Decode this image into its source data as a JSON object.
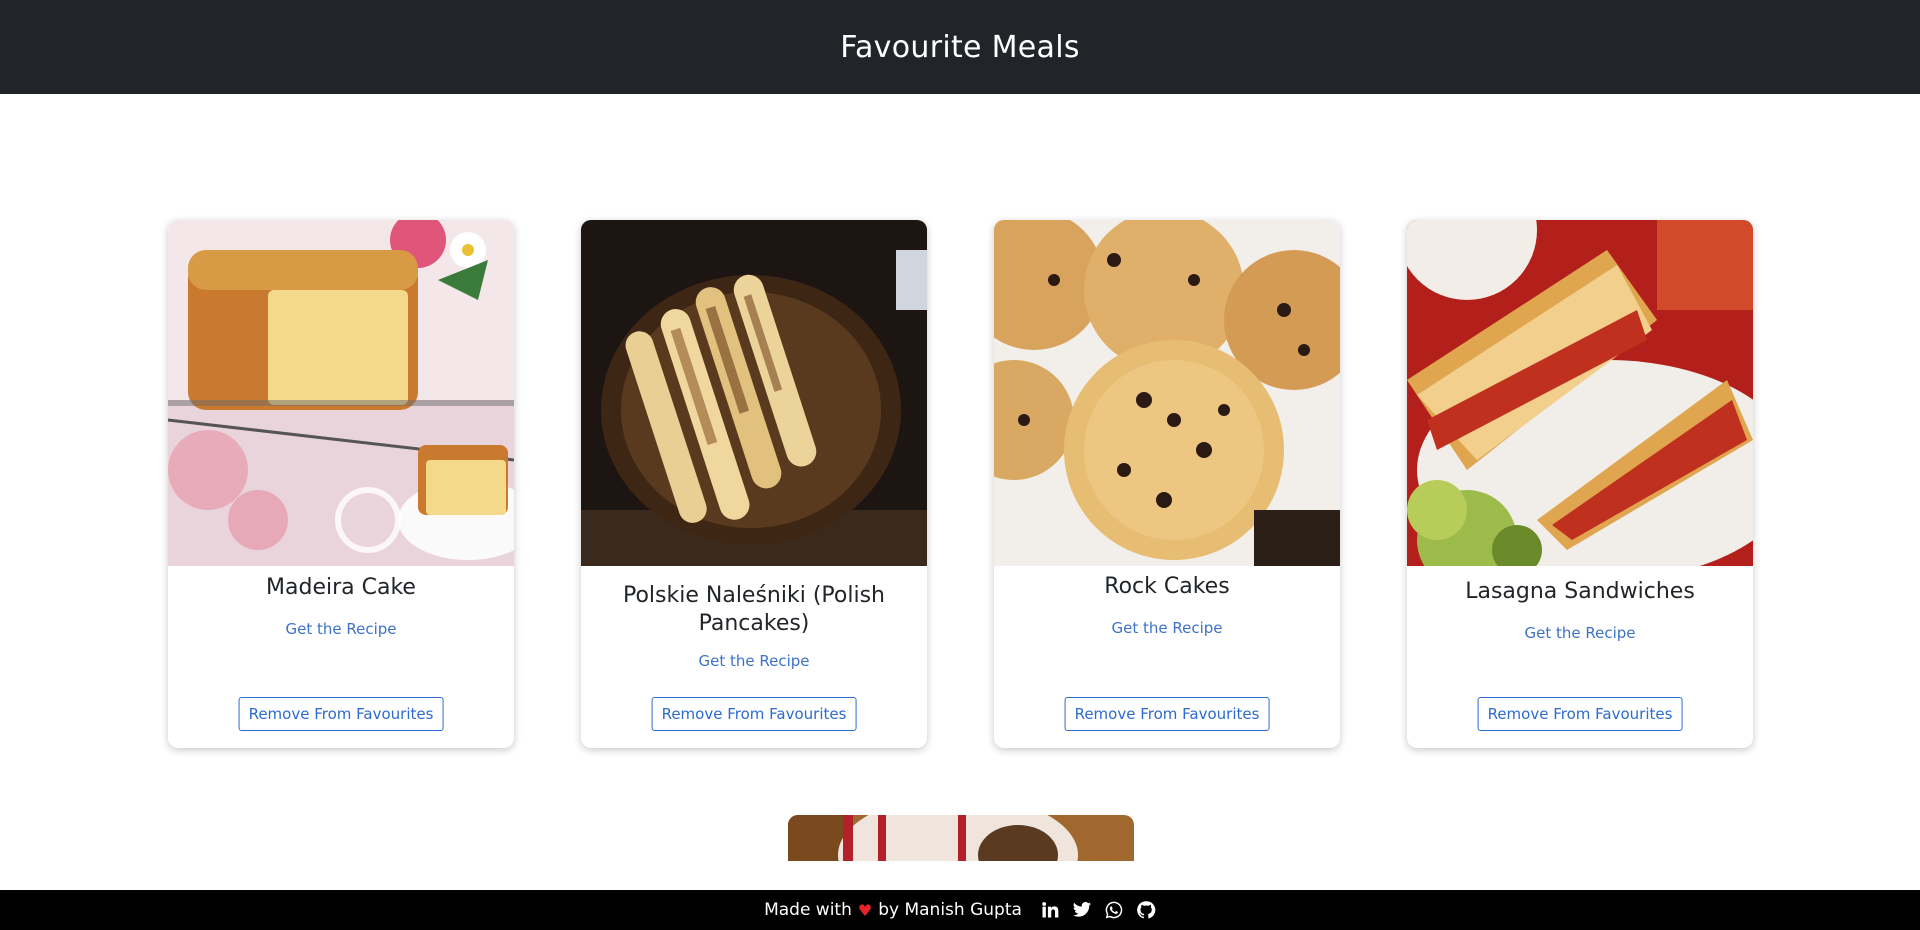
{
  "header": {
    "title": "Favourite Meals"
  },
  "meals": [
    {
      "title": "Madeira Cake",
      "link_label": "Get the Recipe",
      "remove_label": "Remove From Favourites"
    },
    {
      "title": "Polskie Naleśniki (Polish Pancakes)",
      "link_label": "Get the Recipe",
      "remove_label": "Remove From Favourites"
    },
    {
      "title": "Rock Cakes",
      "link_label": "Get the Recipe",
      "remove_label": "Remove From Favourites"
    },
    {
      "title": "Lasagna Sandwiches",
      "link_label": "Get the Recipe",
      "remove_label": "Remove From Favourites"
    }
  ],
  "footer": {
    "made_with": "Made with",
    "heart": "♥",
    "by": "by Manish Gupta",
    "socials": [
      "linkedin-icon",
      "twitter-icon",
      "whatsapp-icon",
      "github-icon"
    ]
  },
  "colors": {
    "header_bg": "#212529",
    "footer_bg": "#000000",
    "link": "#3d72c8",
    "button_border": "#2c6bd0",
    "heart": "#e3242b"
  }
}
